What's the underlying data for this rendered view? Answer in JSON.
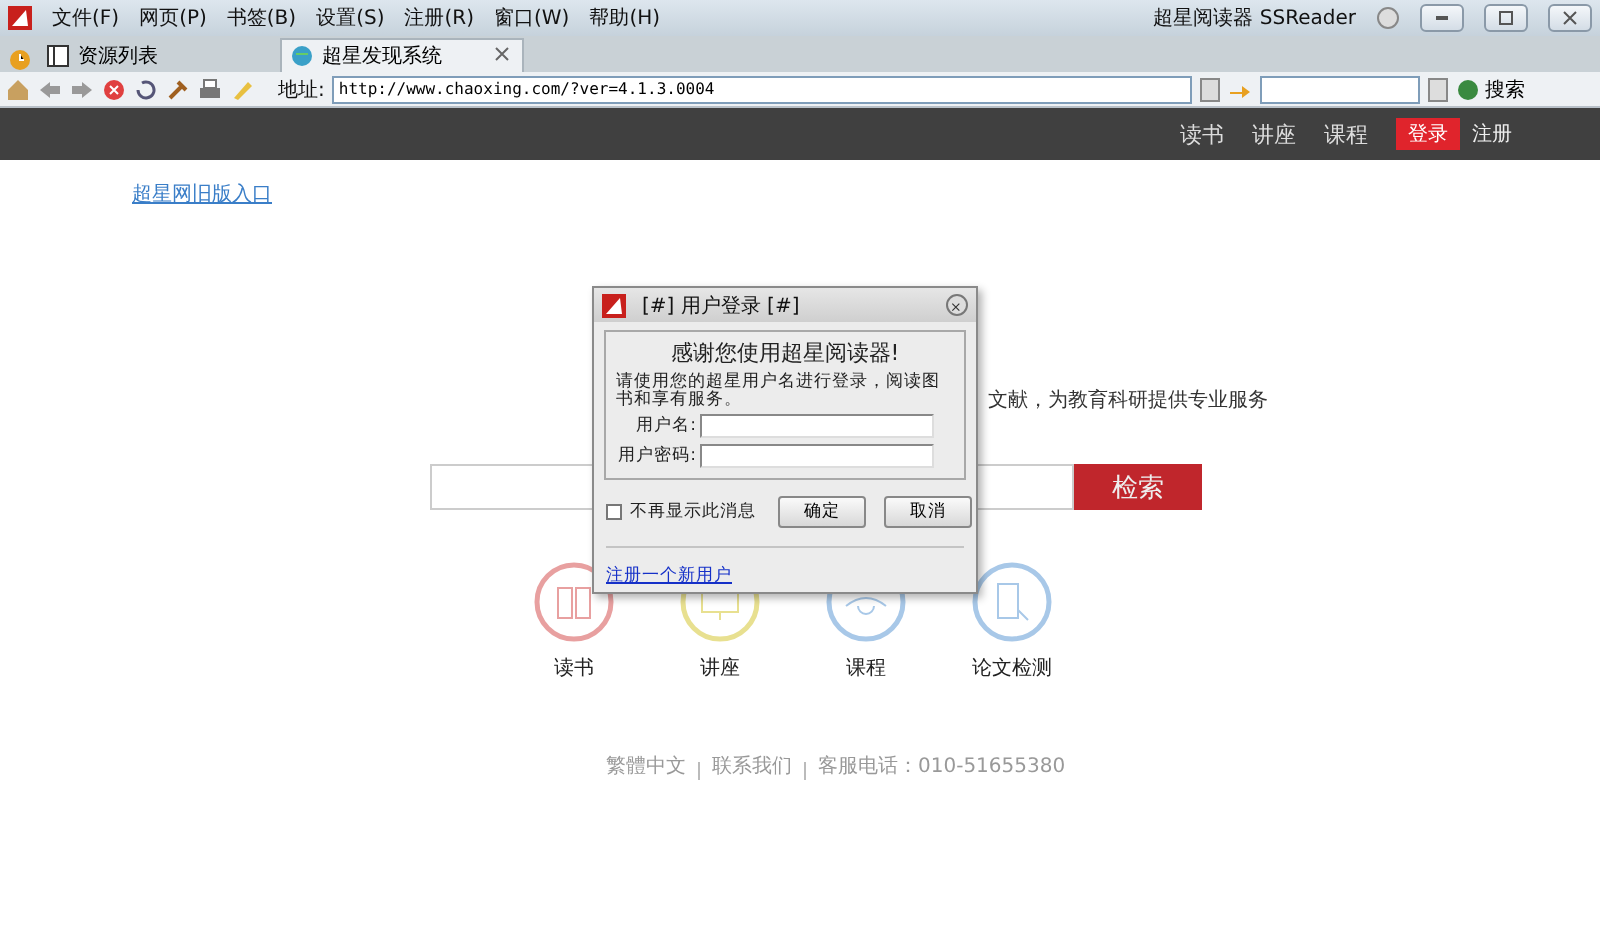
{
  "app": {
    "title": "超星阅读器 SSReader"
  },
  "menu": [
    "文件(F)",
    "网页(P)",
    "书签(B)",
    "设置(S)",
    "注册(R)",
    "窗口(W)",
    "帮助(H)"
  ],
  "tabs": [
    {
      "label": "资源列表",
      "selected": false
    },
    {
      "label": "超星发现系统",
      "selected": true
    }
  ],
  "toolbar": {
    "address_label": "地址:",
    "address": "http://www.chaoxing.com/?ver=4.1.3.0004",
    "search_button": "搜索"
  },
  "nav": {
    "items": [
      "读书",
      "讲座",
      "课程"
    ],
    "login": "登录",
    "register": "注册"
  },
  "page": {
    "old_link": "超星网旧版入口",
    "tagline": "文献，为教育科研提供专业服务",
    "search_button": "检索",
    "features": [
      {
        "label": "读书",
        "color": "#e8a0a0"
      },
      {
        "label": "讲座",
        "color": "#e8e090"
      },
      {
        "label": "课程",
        "color": "#a8c8e8"
      },
      {
        "label": "论文检测",
        "color": "#a8c8e8"
      }
    ],
    "footer": [
      "繁體中文",
      "联系我们",
      "客服电话：010-51655380"
    ]
  },
  "dialog": {
    "title": "[#] 用户登录 [#]",
    "heading": "感谢您使用超星阅读器!",
    "message": "请使用您的超星用户名进行登录，阅读图书和享有服务。",
    "fields": [
      {
        "label": "用户名:"
      },
      {
        "label": "用户密码:"
      }
    ],
    "checkbox": {
      "label": "不再显示此消息",
      "checked": false
    },
    "buttons": [
      "确定",
      "取消"
    ],
    "link": "注册一个新用户"
  }
}
